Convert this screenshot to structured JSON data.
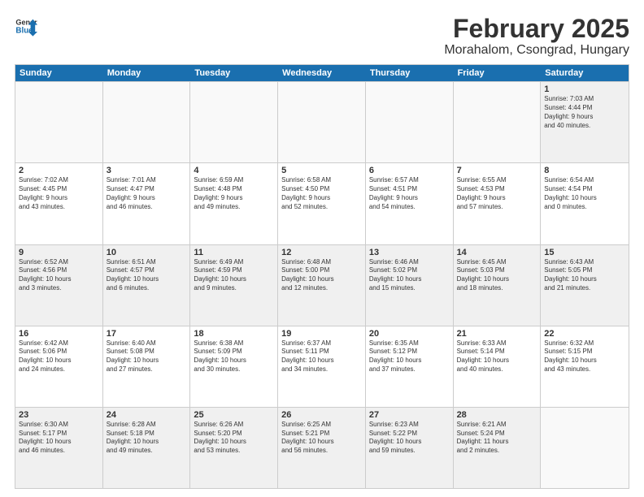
{
  "header": {
    "logo_line1": "General",
    "logo_line2": "Blue",
    "main_title": "February 2025",
    "subtitle": "Morahalom, Csongrad, Hungary"
  },
  "days_of_week": [
    "Sunday",
    "Monday",
    "Tuesday",
    "Wednesday",
    "Thursday",
    "Friday",
    "Saturday"
  ],
  "weeks": [
    [
      {
        "day": "",
        "text": "",
        "empty": true
      },
      {
        "day": "",
        "text": "",
        "empty": true
      },
      {
        "day": "",
        "text": "",
        "empty": true
      },
      {
        "day": "",
        "text": "",
        "empty": true
      },
      {
        "day": "",
        "text": "",
        "empty": true
      },
      {
        "day": "",
        "text": "",
        "empty": true
      },
      {
        "day": "1",
        "text": "Sunrise: 7:03 AM\nSunset: 4:44 PM\nDaylight: 9 hours\nand 40 minutes.",
        "empty": false
      }
    ],
    [
      {
        "day": "2",
        "text": "Sunrise: 7:02 AM\nSunset: 4:45 PM\nDaylight: 9 hours\nand 43 minutes.",
        "empty": false
      },
      {
        "day": "3",
        "text": "Sunrise: 7:01 AM\nSunset: 4:47 PM\nDaylight: 9 hours\nand 46 minutes.",
        "empty": false
      },
      {
        "day": "4",
        "text": "Sunrise: 6:59 AM\nSunset: 4:48 PM\nDaylight: 9 hours\nand 49 minutes.",
        "empty": false
      },
      {
        "day": "5",
        "text": "Sunrise: 6:58 AM\nSunset: 4:50 PM\nDaylight: 9 hours\nand 52 minutes.",
        "empty": false
      },
      {
        "day": "6",
        "text": "Sunrise: 6:57 AM\nSunset: 4:51 PM\nDaylight: 9 hours\nand 54 minutes.",
        "empty": false
      },
      {
        "day": "7",
        "text": "Sunrise: 6:55 AM\nSunset: 4:53 PM\nDaylight: 9 hours\nand 57 minutes.",
        "empty": false
      },
      {
        "day": "8",
        "text": "Sunrise: 6:54 AM\nSunset: 4:54 PM\nDaylight: 10 hours\nand 0 minutes.",
        "empty": false
      }
    ],
    [
      {
        "day": "9",
        "text": "Sunrise: 6:52 AM\nSunset: 4:56 PM\nDaylight: 10 hours\nand 3 minutes.",
        "empty": false
      },
      {
        "day": "10",
        "text": "Sunrise: 6:51 AM\nSunset: 4:57 PM\nDaylight: 10 hours\nand 6 minutes.",
        "empty": false
      },
      {
        "day": "11",
        "text": "Sunrise: 6:49 AM\nSunset: 4:59 PM\nDaylight: 10 hours\nand 9 minutes.",
        "empty": false
      },
      {
        "day": "12",
        "text": "Sunrise: 6:48 AM\nSunset: 5:00 PM\nDaylight: 10 hours\nand 12 minutes.",
        "empty": false
      },
      {
        "day": "13",
        "text": "Sunrise: 6:46 AM\nSunset: 5:02 PM\nDaylight: 10 hours\nand 15 minutes.",
        "empty": false
      },
      {
        "day": "14",
        "text": "Sunrise: 6:45 AM\nSunset: 5:03 PM\nDaylight: 10 hours\nand 18 minutes.",
        "empty": false
      },
      {
        "day": "15",
        "text": "Sunrise: 6:43 AM\nSunset: 5:05 PM\nDaylight: 10 hours\nand 21 minutes.",
        "empty": false
      }
    ],
    [
      {
        "day": "16",
        "text": "Sunrise: 6:42 AM\nSunset: 5:06 PM\nDaylight: 10 hours\nand 24 minutes.",
        "empty": false
      },
      {
        "day": "17",
        "text": "Sunrise: 6:40 AM\nSunset: 5:08 PM\nDaylight: 10 hours\nand 27 minutes.",
        "empty": false
      },
      {
        "day": "18",
        "text": "Sunrise: 6:38 AM\nSunset: 5:09 PM\nDaylight: 10 hours\nand 30 minutes.",
        "empty": false
      },
      {
        "day": "19",
        "text": "Sunrise: 6:37 AM\nSunset: 5:11 PM\nDaylight: 10 hours\nand 34 minutes.",
        "empty": false
      },
      {
        "day": "20",
        "text": "Sunrise: 6:35 AM\nSunset: 5:12 PM\nDaylight: 10 hours\nand 37 minutes.",
        "empty": false
      },
      {
        "day": "21",
        "text": "Sunrise: 6:33 AM\nSunset: 5:14 PM\nDaylight: 10 hours\nand 40 minutes.",
        "empty": false
      },
      {
        "day": "22",
        "text": "Sunrise: 6:32 AM\nSunset: 5:15 PM\nDaylight: 10 hours\nand 43 minutes.",
        "empty": false
      }
    ],
    [
      {
        "day": "23",
        "text": "Sunrise: 6:30 AM\nSunset: 5:17 PM\nDaylight: 10 hours\nand 46 minutes.",
        "empty": false
      },
      {
        "day": "24",
        "text": "Sunrise: 6:28 AM\nSunset: 5:18 PM\nDaylight: 10 hours\nand 49 minutes.",
        "empty": false
      },
      {
        "day": "25",
        "text": "Sunrise: 6:26 AM\nSunset: 5:20 PM\nDaylight: 10 hours\nand 53 minutes.",
        "empty": false
      },
      {
        "day": "26",
        "text": "Sunrise: 6:25 AM\nSunset: 5:21 PM\nDaylight: 10 hours\nand 56 minutes.",
        "empty": false
      },
      {
        "day": "27",
        "text": "Sunrise: 6:23 AM\nSunset: 5:22 PM\nDaylight: 10 hours\nand 59 minutes.",
        "empty": false
      },
      {
        "day": "28",
        "text": "Sunrise: 6:21 AM\nSunset: 5:24 PM\nDaylight: 11 hours\nand 2 minutes.",
        "empty": false
      },
      {
        "day": "",
        "text": "",
        "empty": true
      }
    ]
  ]
}
